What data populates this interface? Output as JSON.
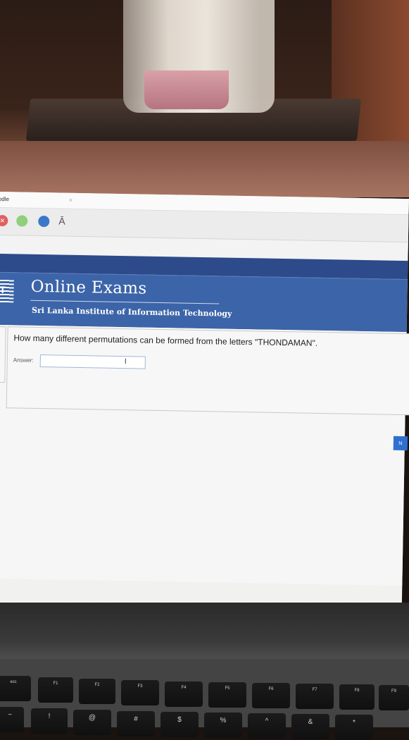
{
  "browser": {
    "tab_title": "odle",
    "tab_close": "×",
    "font_button": "Ā"
  },
  "banner": {
    "title": "Online Exams",
    "subtitle": "Sri Lanka Institute of Information Technology",
    "logo_text": "IT"
  },
  "question": {
    "text": "How many different permutations can be formed from the letters \"THONDAMAN\".",
    "answer_label": "Answer:",
    "answer_value": "",
    "cursor": "I"
  },
  "navigation": {
    "next_label": "N"
  },
  "keyboard": {
    "fn_row": [
      "esc",
      "F1",
      "F2",
      "F3",
      "F4",
      "F5",
      "F6",
      "F7",
      "F8",
      "F9"
    ],
    "num_row": [
      "~",
      "!",
      "@",
      "#",
      "$",
      "%",
      "^",
      "&",
      "*"
    ]
  },
  "colors": {
    "banner_bg": "#3c64a8",
    "header_dark": "#2d4a8a",
    "next_button": "#2f6fd0"
  }
}
